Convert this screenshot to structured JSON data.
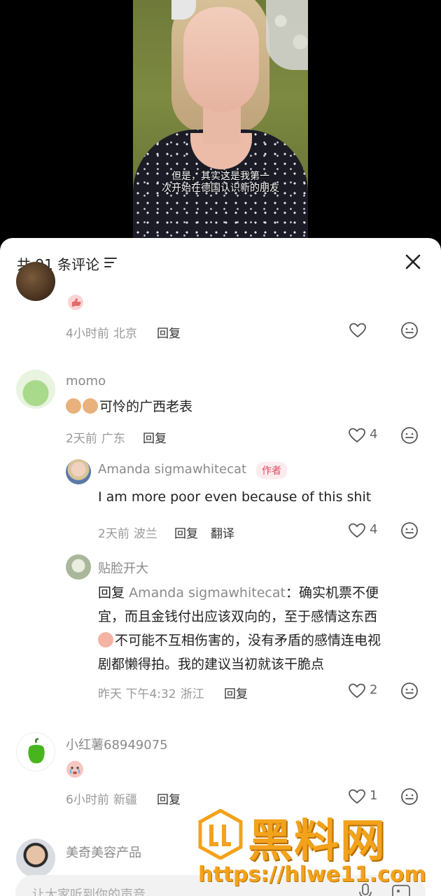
{
  "video": {
    "subtitle_line1": "但是，其实这是我第一",
    "subtitle_line2": "次开始在德国认识新的朋友"
  },
  "header": {
    "title": "共 91 条评论",
    "sort_icon": "sort-filter-icon",
    "close_icon": "close-icon"
  },
  "comments": [
    {
      "emoji": "thumbs-up-emoji",
      "time": "4小时前",
      "location": "北京",
      "reply_label": "回复",
      "likes": ""
    },
    {
      "name": "momo",
      "text": "可怜的广西老表",
      "time": "2天前",
      "location": "广东",
      "reply_label": "回复",
      "likes": "4",
      "replies": [
        {
          "name": "Amanda sigmawhitecat",
          "badge": "作者",
          "text": "I am more poor even because of this shit",
          "time": "2天前",
          "location": "波兰",
          "reply_label": "回复",
          "translate_label": "翻译",
          "likes": "4"
        },
        {
          "name": "贴脸开大",
          "reply_prefix": "回复",
          "reply_to": "Amanda sigmawhitecat",
          "text_line1": "：确实机票不便",
          "text_line2": "宜，而且金钱付出应该双向的，至于感情这东西",
          "text_line3": "不可能不互相伤害的，没有矛盾的感情连电视",
          "text_line4": "剧都懒得拍。我的建议当初就该干脆点",
          "time": "昨天 下午4:32",
          "location": "浙江",
          "reply_label": "回复",
          "likes": "2"
        }
      ]
    },
    {
      "name": "小红薯68949075",
      "emoji": "crying-face-emoji",
      "time": "6小时前",
      "location": "新疆",
      "reply_label": "回复",
      "likes": "1"
    },
    {
      "name": "美奇美容产品"
    }
  ],
  "watermark": {
    "brand": "黑料网",
    "url": "https://hlwe11.com"
  },
  "input": {
    "placeholder": "让大家听到你的声音"
  },
  "colors": {
    "accent_red": "#e5485f",
    "watermark_orange": "#f3a21b"
  }
}
